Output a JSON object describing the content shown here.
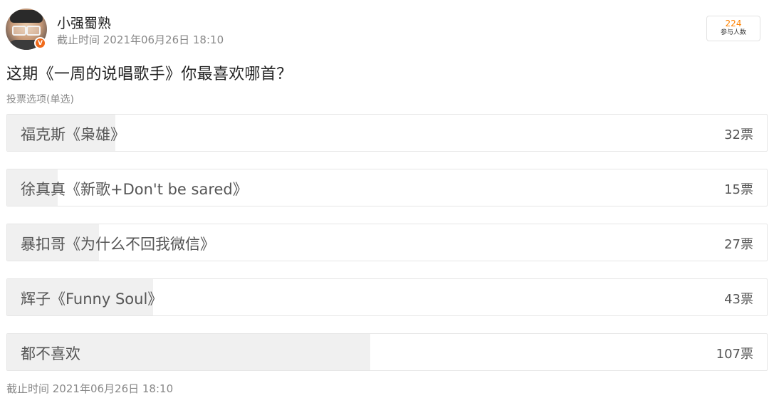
{
  "user": {
    "name": "小强蜀熟",
    "time": "截止时间 2021年06月26日 18:10",
    "verified_badge": "V"
  },
  "participants": {
    "count": "224",
    "label": "参与人数"
  },
  "poll": {
    "question": "这期《一周的说唱歌手》你最喜欢哪首？",
    "type_label": "投票选项(单选)",
    "options": [
      {
        "label": "福克斯《枭雄》",
        "votes": "32票",
        "value": 32
      },
      {
        "label": "徐真真《新歌+Don't be sared》",
        "votes": "15票",
        "value": 15
      },
      {
        "label": "暴扣哥《为什么不回我微信》",
        "votes": "27票",
        "value": 27
      },
      {
        "label": "辉子《Funny Soul》",
        "votes": "43票",
        "value": 43
      },
      {
        "label": "都不喜欢",
        "votes": "107票",
        "value": 107
      }
    ],
    "total": 224
  },
  "footer": {
    "deadline": "截止时间 2021年06月26日 18:10"
  },
  "colors": {
    "accent": "#ff8200",
    "verified": "#f06a1b",
    "fill": "#f0f0f0"
  }
}
